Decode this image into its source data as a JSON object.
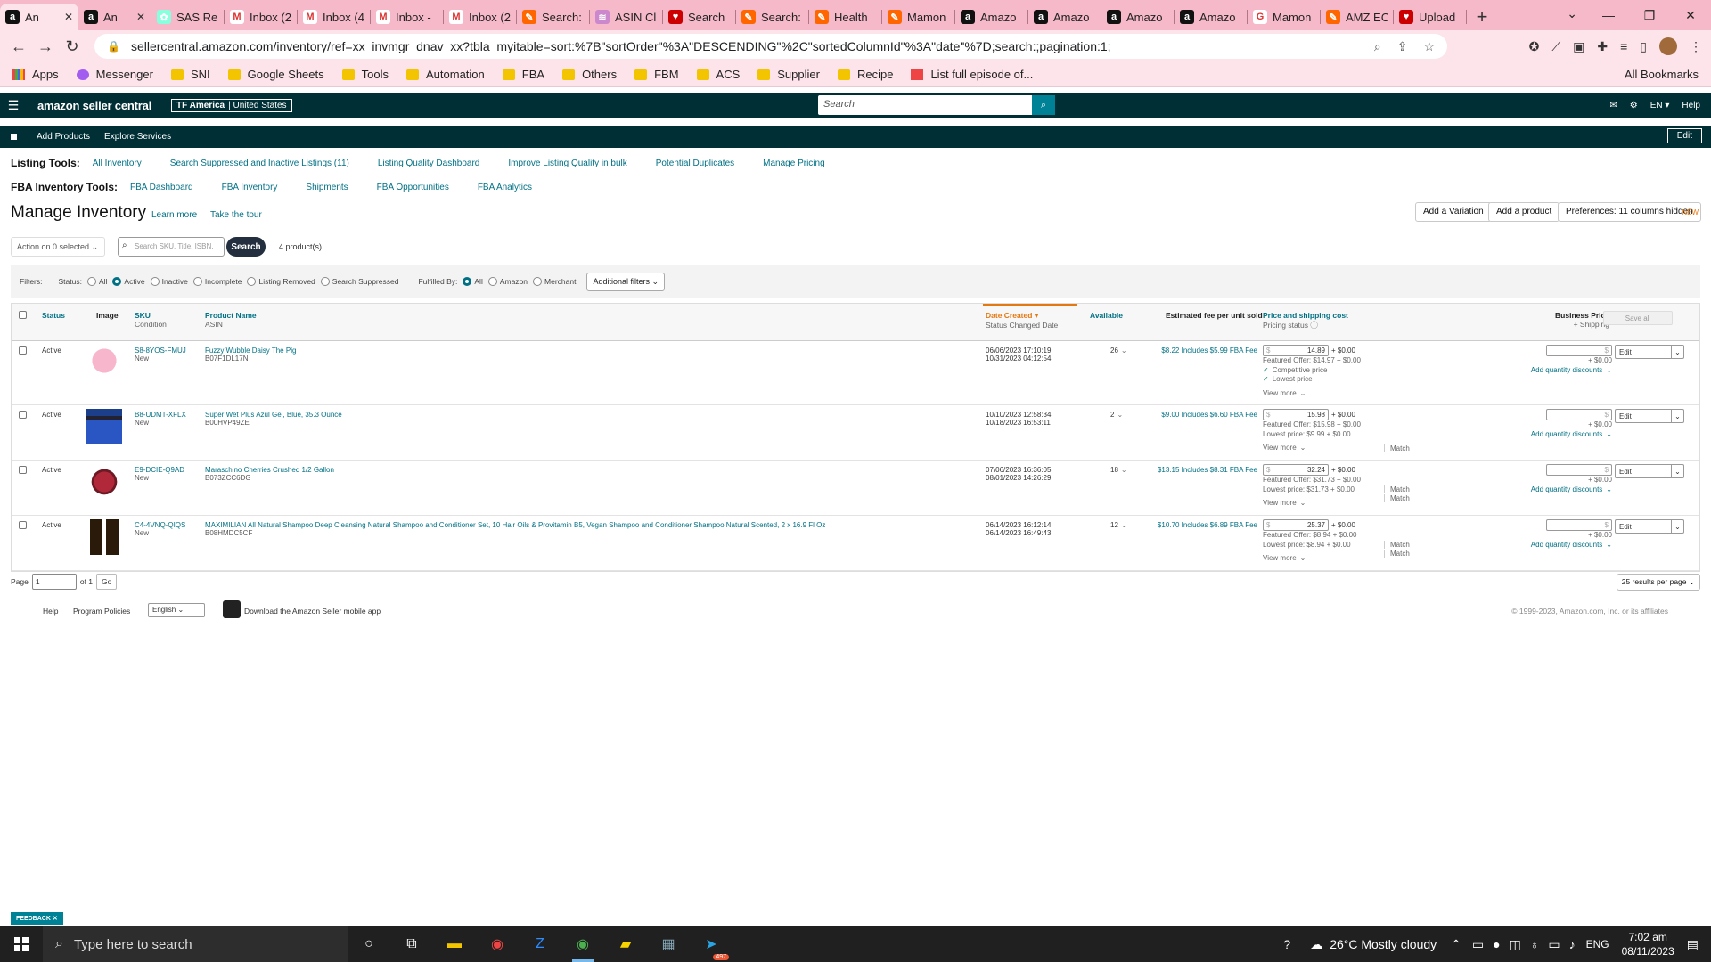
{
  "browser": {
    "tabs": [
      {
        "title": "An",
        "icon": "amazon-a",
        "active": true
      },
      {
        "title": "An",
        "icon": "amazon-a"
      },
      {
        "title": "SAS Re",
        "icon": "sas"
      },
      {
        "title": "Inbox (2",
        "icon": "gmail"
      },
      {
        "title": "Inbox (4",
        "icon": "gmail"
      },
      {
        "title": "Inbox -",
        "icon": "gmail"
      },
      {
        "title": "Inbox (2",
        "icon": "gmail"
      },
      {
        "title": "Search:",
        "icon": "keepa"
      },
      {
        "title": "ASIN Cl",
        "icon": "helium"
      },
      {
        "title": "Search",
        "icon": "heart"
      },
      {
        "title": "Search:",
        "icon": "keepa"
      },
      {
        "title": "Health",
        "icon": "keepa"
      },
      {
        "title": "Mamon",
        "icon": "keepa"
      },
      {
        "title": "Amazo",
        "icon": "amazon-a"
      },
      {
        "title": "Amazo",
        "icon": "amazon-a"
      },
      {
        "title": "Amazo",
        "icon": "amazon-a"
      },
      {
        "title": "Amazo",
        "icon": "amazon-a"
      },
      {
        "title": "Mamon",
        "icon": "google"
      },
      {
        "title": "AMZ EC",
        "icon": "pen"
      },
      {
        "title": "Upload",
        "icon": "heart"
      }
    ],
    "url": "sellercentral.amazon.com/inventory/ref=xx_invmgr_dnav_xx?tbla_myitable=sort:%7B\"sortOrder\"%3A\"DESCENDING\"%2C\"sortedColumnId\"%3A\"date\"%7D;search:;pagination:1;",
    "bookmarks": [
      "Apps",
      "Messenger",
      "SNI",
      "Google Sheets",
      "Tools",
      "Automation",
      "FBA",
      "Others",
      "FBM",
      "ACS",
      "Supplier",
      "Recipe",
      "List full episode of..."
    ],
    "all_bookmarks": "All Bookmarks"
  },
  "header": {
    "logo": "amazon seller central",
    "store_name": "TF America",
    "store_region": "United States",
    "search_placeholder": "Search",
    "lang": "EN",
    "help": "Help",
    "sub_links": [
      "Add Products",
      "Explore Services"
    ],
    "edit": "Edit"
  },
  "tools": {
    "listing_label": "Listing Tools:",
    "listing_links": [
      "All Inventory",
      "Search Suppressed and Inactive Listings (11)",
      "Listing Quality Dashboard",
      "Improve Listing Quality in bulk",
      "Potential Duplicates",
      "Manage Pricing"
    ],
    "fba_label": "FBA Inventory Tools:",
    "fba_links": [
      "FBA Dashboard",
      "FBA Inventory",
      "Shipments",
      "FBA Opportunities",
      "FBA Analytics"
    ]
  },
  "page": {
    "title": "Manage Inventory",
    "learn_more": "Learn more",
    "tour": "Take the tour",
    "btn_variation": "Add a Variation",
    "btn_product": "Add a product",
    "btn_prefs": "Preferences: 11 columns hidden",
    "new_tag": "NEW",
    "action": "Action on 0 selected",
    "search_placeholder": "Search SKU, Title, ISBN,",
    "search_btn": "Search",
    "product_count": "4 product(s)"
  },
  "filters": {
    "label": "Filters:",
    "status_label": "Status:",
    "status": [
      "All",
      "Active",
      "Inactive",
      "Incomplete",
      "Listing Removed",
      "Search Suppressed"
    ],
    "fulfilled_label": "Fulfilled By:",
    "fulfilled": [
      "All",
      "Amazon",
      "Merchant"
    ],
    "additional": "Additional filters"
  },
  "table": {
    "headers": {
      "status": "Status",
      "image": "Image",
      "sku": "SKU",
      "condition": "Condition",
      "product_name": "Product Name",
      "asin": "ASIN",
      "date_created": "Date Created",
      "status_changed": "Status Changed Date",
      "available": "Available",
      "fee": "Estimated fee per unit sold",
      "price": "Price and shipping cost",
      "pricing_status": "Pricing status",
      "business_price": "Business Price",
      "plus_shipping": "+ Shipping",
      "save_all": "Save all"
    },
    "rows": [
      {
        "status": "Active",
        "sku": "S8-8YOS-FMUJ",
        "condition": "New",
        "name": "Fuzzy Wubble Daisy The Pig",
        "asin": "B07F1DL17N",
        "created": "06/06/2023 17:10:19",
        "changed": "10/31/2023 04:12:54",
        "available": "26",
        "fee": "$8.22 Includes $5.99 FBA Fee",
        "price": "14.89",
        "shipping": "+ $0.00",
        "featured": "Featured Offer: $14.97 + $0.00",
        "line2": "Competitive price",
        "line3": "Lowest price",
        "view_more": "View more",
        "biz_shipping": "+ $0.00",
        "qty_disc": "Add quantity discounts",
        "edit": "Edit"
      },
      {
        "status": "Active",
        "sku": "B8-UDMT-XFLX",
        "condition": "New",
        "name": "Super Wet Plus Azul Gel, Blue, 35.3 Ounce",
        "asin": "B00HVP49ZE",
        "created": "10/10/2023 12:58:34",
        "changed": "10/18/2023 16:53:11",
        "available": "2",
        "fee": "$9.00 Includes $6.60 FBA Fee",
        "price": "15.98",
        "shipping": "+ $0.00",
        "featured": "Featured Offer: $15.98 + $0.00",
        "lowest": "Lowest price: $9.99 + $0.00",
        "match": "Match",
        "view_more": "View more",
        "biz_shipping": "+ $0.00",
        "qty_disc": "Add quantity discounts",
        "edit": "Edit"
      },
      {
        "status": "Active",
        "sku": "E9-DCIE-Q9AD",
        "condition": "New",
        "name": "Maraschino Cherries Crushed 1/2 Gallon",
        "asin": "B073ZCC6DG",
        "created": "07/06/2023 16:36:05",
        "changed": "08/01/2023 14:26:29",
        "available": "18",
        "fee": "$13.15 Includes $8.31 FBA Fee",
        "price": "32.24",
        "shipping": "+ $0.00",
        "featured": "Featured Offer: $31.73 + $0.00",
        "lowest": "Lowest price: $31.73 + $0.00",
        "match": "Match",
        "match2": "Match",
        "view_more": "View more",
        "biz_shipping": "+ $0.00",
        "qty_disc": "Add quantity discounts",
        "edit": "Edit"
      },
      {
        "status": "Active",
        "sku": "C4-4VNQ-QIQS",
        "condition": "New",
        "name": "MAXIMILIAN All Natural Shampoo Deep Cleansing Natural Shampoo and Conditioner Set, 10 Hair Oils & Provitamin B5, Vegan Shampoo and Conditioner Shampoo Natural Scented, 2 x 16.9 Fl Oz",
        "asin": "B08HMDC5CF",
        "created": "06/14/2023 16:12:14",
        "changed": "06/14/2023 16:49:43",
        "available": "12",
        "fee": "$10.70 Includes $6.89 FBA Fee",
        "price": "25.37",
        "shipping": "+ $0.00",
        "featured": "Featured Offer: $8.94 + $0.00",
        "lowest": "Lowest price: $8.94 + $0.00",
        "match": "Match",
        "match2": "Match",
        "view_more": "View more",
        "biz_shipping": "+ $0.00",
        "qty_disc": "Add quantity discounts",
        "edit": "Edit"
      }
    ]
  },
  "pager": {
    "label": "Page",
    "value": "1",
    "of": "of 1",
    "go": "Go",
    "per_page": "25 results per page"
  },
  "footer": {
    "help": "Help",
    "policies": "Program Policies",
    "language": "English",
    "app": "Download the Amazon Seller mobile app",
    "copyright": "© 1999-2023, Amazon.com, Inc. or its affiliates"
  },
  "feedback": "FEEDBACK",
  "taskbar": {
    "search": "Type here to search",
    "weather": "26°C  Mostly cloudy",
    "lang": "ENG",
    "time": "7:02 am",
    "date": "08/11/2023",
    "telegram_badge": "497"
  }
}
